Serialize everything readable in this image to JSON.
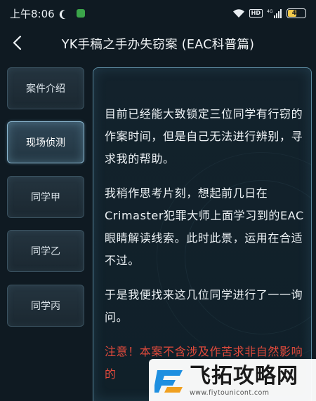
{
  "status_bar": {
    "time": "上午8:06",
    "hd_label": "HD",
    "network": "4G",
    "battery": "47",
    "battery_level": 0.47
  },
  "header": {
    "title": "YK手稿之手办失窃案 (EAC科普篇)"
  },
  "sidebar": {
    "items": [
      {
        "label": "案件介绍",
        "active": false
      },
      {
        "label": "现场侦测",
        "active": true
      },
      {
        "label": "同学甲",
        "active": false
      },
      {
        "label": "同学乙",
        "active": false
      },
      {
        "label": "同学丙",
        "active": false
      }
    ]
  },
  "content": {
    "paragraphs": [
      "目前已经能大致锁定三位同学有行窃的作案时间，但是自己无法进行辨别，寻求我的帮助。",
      "我稍作思考片刻，想起前几日在Crimaster犯罪大师上面学习到的EAC眼睛解读线索。此时此景，运用在合适不过。",
      "于是我便找来这几位同学进行了一一询问。"
    ],
    "warning": "注意！本案不含涉及作苦求非自然影响的"
  },
  "watermark": {
    "brand": "飞拓攻略网",
    "url": "www.fiytounicont.com"
  },
  "colors": {
    "background": "#0f1a22",
    "panel_border": "#5c8aa0",
    "warning": "#e24a3c",
    "battery_fill": "#f2c94c"
  }
}
